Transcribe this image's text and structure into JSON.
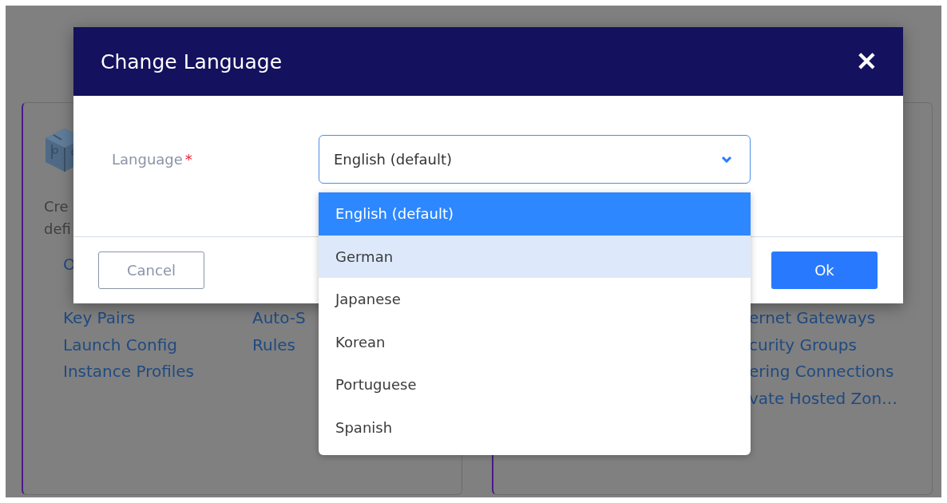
{
  "background": {
    "cards": [
      {
        "description": [
          "Cre",
          "defi"
        ],
        "columns": [
          [
            "O",
            "",
            "Key Pairs",
            "Launch Config",
            "Instance Profiles"
          ],
          [
            "Auto-S",
            "Rules"
          ]
        ]
      },
      {
        "columns": [
          [],
          [
            "ernet Gateways",
            "curity Groups",
            "ering Connections",
            "vate Hosted Zon…"
          ]
        ]
      }
    ]
  },
  "dialog": {
    "title": "Change Language",
    "close": "✕",
    "field": {
      "label": "Language",
      "required_mark": "*",
      "value": "English (default)",
      "expanded": true
    },
    "options": [
      {
        "label": "English (default)",
        "selected": true,
        "hovered": false
      },
      {
        "label": "German",
        "selected": false,
        "hovered": true
      },
      {
        "label": "Japanese",
        "selected": false,
        "hovered": false
      },
      {
        "label": "Korean",
        "selected": false,
        "hovered": false
      },
      {
        "label": "Portuguese",
        "selected": false,
        "hovered": false
      },
      {
        "label": "Spanish",
        "selected": false,
        "hovered": false
      }
    ],
    "buttons": [
      {
        "label": "Cancel",
        "kind": "secondary"
      },
      {
        "label": "Ok",
        "kind": "primary"
      }
    ]
  }
}
